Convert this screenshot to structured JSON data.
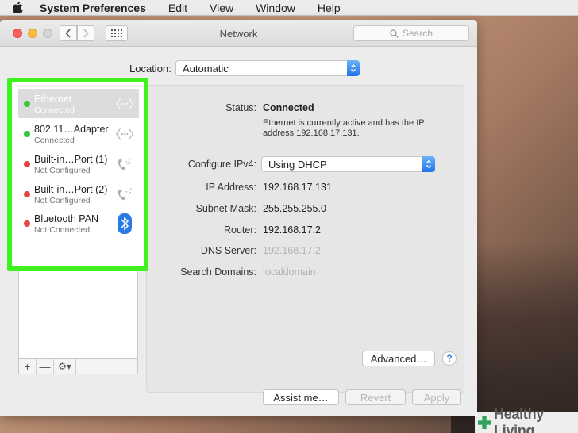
{
  "menubar": {
    "app_name": "System Preferences",
    "items": [
      "Edit",
      "View",
      "Window",
      "Help"
    ]
  },
  "window": {
    "title": "Network",
    "search_placeholder": "Search"
  },
  "location": {
    "label": "Location:",
    "value": "Automatic"
  },
  "services": [
    {
      "name": "Ethernet",
      "status": "Connected",
      "state": "green",
      "icon": "ethernet-icon",
      "selected": true
    },
    {
      "name": "802.11…Adapter",
      "status": "Connected",
      "state": "green",
      "icon": "ethernet-icon",
      "selected": false
    },
    {
      "name": "Built-in…Port (1)",
      "status": "Not Configured",
      "state": "red",
      "icon": "phone-icon",
      "selected": false
    },
    {
      "name": "Built-in…Port (2)",
      "status": "Not Configured",
      "state": "red",
      "icon": "phone-icon",
      "selected": false
    },
    {
      "name": "Bluetooth PAN",
      "status": "Not Connected",
      "state": "red",
      "icon": "bluetooth-icon",
      "selected": false
    }
  ],
  "list_footer": {
    "add": "+",
    "remove": "—",
    "gear": "⚙▾"
  },
  "detail": {
    "status_label": "Status:",
    "status_value": "Connected",
    "status_description": "Ethernet is currently active and has the IP address 192.168.17.131.",
    "configure_label": "Configure IPv4:",
    "configure_value": "Using DHCP",
    "ip_label": "IP Address:",
    "ip_value": "192.168.17.131",
    "subnet_label": "Subnet Mask:",
    "subnet_value": "255.255.255.0",
    "router_label": "Router:",
    "router_value": "192.168.17.2",
    "dns_label": "DNS Server:",
    "dns_value": "192.168.17.2",
    "search_domains_label": "Search Domains:",
    "search_domains_value": "localdomain"
  },
  "buttons": {
    "advanced": "Advanced…",
    "help": "?",
    "assist": "Assist me…",
    "revert": "Revert",
    "apply": "Apply"
  },
  "watermark": {
    "text": "Healthy Living"
  },
  "colors": {
    "highlight": "#3ff21e",
    "accent": "#1f73e8",
    "status_green": "#34c73a",
    "status_red": "#e9443f"
  }
}
